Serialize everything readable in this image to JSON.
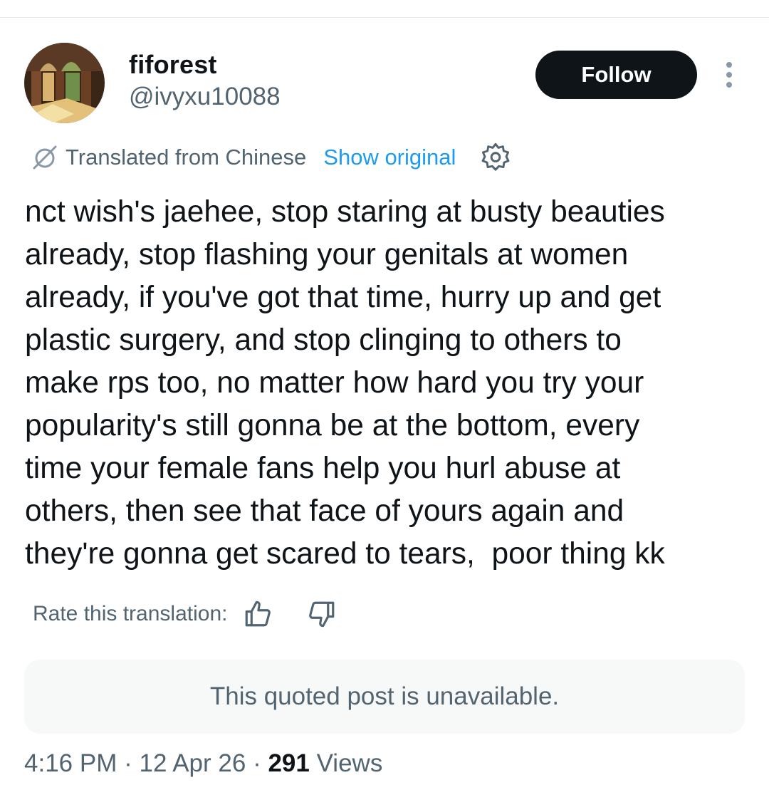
{
  "author": {
    "display_name": "fiforest",
    "handle": "@ivyxu10088"
  },
  "follow_label": "Follow",
  "translation": {
    "label": "Translated from Chinese",
    "show_original": "Show original"
  },
  "post_text": "nct wish's jaehee, stop staring at busty beauties\nalready, stop flashing your genitals at women\nalready, if you've got that time, hurry up and get\nplastic surgery, and stop clinging to others to\nmake rps too, no matter how hard you try your\npopularity's still gonna be at the bottom, every\ntime your female fans help you hurl abuse at\nothers, then see that face of yours again and\nthey're gonna get scared to tears,  poor thing kk",
  "rate_translation_label": "Rate this translation:",
  "quoted_post_text": "This quoted post is unavailable.",
  "meta": {
    "time": "4:16 PM",
    "separator": "·",
    "date": "12 Apr 26",
    "views_count": "291",
    "views_label": "Views"
  },
  "icons": {
    "translate": "translate-icon",
    "settings": "gear-icon",
    "more": "more-vertical-icon",
    "thumb_up": "thumbs-up-icon",
    "thumb_down": "thumbs-down-icon"
  },
  "colors": {
    "text_primary": "#0f1419",
    "text_secondary": "#536471",
    "link_blue": "#1d9bf0",
    "follow_button_bg": "#0f1419",
    "quoted_box_bg": "#f7f9f9"
  }
}
